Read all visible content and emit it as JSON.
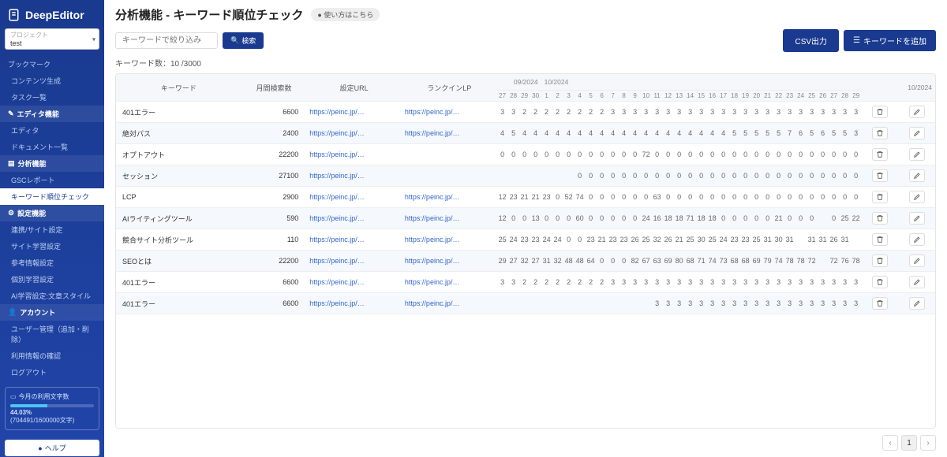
{
  "app_name": "DeepEditor",
  "project": {
    "label": "プロジェクト",
    "value": "test"
  },
  "sidebar": {
    "items": [
      {
        "label": "ブックマーク",
        "type": "item"
      },
      {
        "label": "コンテンツ生成",
        "type": "sub"
      },
      {
        "label": "タスク一覧",
        "type": "sub"
      },
      {
        "label": "エディタ機能",
        "type": "section",
        "icon": "edit"
      },
      {
        "label": "エディタ",
        "type": "sub"
      },
      {
        "label": "ドキュメント一覧",
        "type": "sub"
      },
      {
        "label": "分析機能",
        "type": "section",
        "icon": "chart"
      },
      {
        "label": "GSCレポート",
        "type": "sub"
      },
      {
        "label": "キーワード順位チェック",
        "type": "sub",
        "active": true
      },
      {
        "label": "設定機能",
        "type": "section",
        "icon": "gear"
      },
      {
        "label": "連携/サイト設定",
        "type": "sub"
      },
      {
        "label": "サイト学習設定",
        "type": "sub"
      },
      {
        "label": "参考情報設定",
        "type": "sub"
      },
      {
        "label": "個別学習設定",
        "type": "sub"
      },
      {
        "label": "AI学習設定:文章スタイル",
        "type": "sub"
      },
      {
        "label": "アカウント",
        "type": "section",
        "icon": "user"
      },
      {
        "label": "ユーザー管理（追加・削除）",
        "type": "sub"
      },
      {
        "label": "利用情報の確認",
        "type": "sub"
      },
      {
        "label": "ログアウト",
        "type": "sub"
      }
    ],
    "usage": {
      "title": "今月の利用文字数",
      "percent": "44.03%",
      "detail": "(704491/1600000文字)"
    },
    "help": "ヘルプ"
  },
  "header": {
    "title": "分析機能 - キーワード順位チェック",
    "howto": "● 使い方はこちら"
  },
  "toolbar": {
    "search_placeholder": "キーワードで絞り込み",
    "search_btn": "検索",
    "csv_btn": "CSV出力",
    "add_btn": "キーワードを追加"
  },
  "count_label": "キーワード数：10 /3000",
  "table": {
    "cols": {
      "keyword": "キーワード",
      "volume": "月間検索数",
      "url": "設定URL",
      "rank_lp": "ランクインLP"
    },
    "month_groups": [
      {
        "label": "09/2024",
        "days": [
          "27",
          "28",
          "29",
          "30"
        ]
      },
      {
        "label": "10/2024",
        "days": [
          "1",
          "2",
          "3",
          "4",
          "5",
          "6",
          "7",
          "8",
          "9",
          "10",
          "11",
          "12",
          "13",
          "14",
          "15",
          "16",
          "17",
          "18",
          "19",
          "20",
          "21",
          "22",
          "23",
          "24",
          "25",
          "26",
          "27",
          "28",
          "29"
        ]
      }
    ],
    "month_right_label": "10/2024",
    "rows": [
      {
        "kw": "401エラー",
        "vol": "6600",
        "url": "https://peinc.jp/…",
        "lp": "https://peinc.jp/…",
        "ranks": [
          "3",
          "3",
          "2",
          "2",
          "2",
          "2",
          "2",
          "2",
          "2",
          "2",
          "3",
          "3",
          "3",
          "3",
          "3",
          "3",
          "3",
          "3",
          "3",
          "3",
          "3",
          "3",
          "3",
          "3",
          "3",
          "3",
          "3",
          "3",
          "3",
          "3",
          "3",
          "3",
          "3"
        ]
      },
      {
        "kw": "絶対パス",
        "vol": "2400",
        "url": "https://peinc.jp/…",
        "lp": "https://peinc.jp/…",
        "ranks": [
          "4",
          "5",
          "4",
          "4",
          "4",
          "4",
          "4",
          "4",
          "4",
          "4",
          "4",
          "4",
          "4",
          "4",
          "4",
          "4",
          "4",
          "4",
          "4",
          "4",
          "4",
          "5",
          "5",
          "5",
          "5",
          "5",
          "7",
          "6",
          "5",
          "6",
          "5",
          "5",
          "3"
        ]
      },
      {
        "kw": "オプトアウト",
        "vol": "22200",
        "url": "https://peinc.jp/…",
        "lp": "",
        "ranks": [
          "0",
          "0",
          "0",
          "0",
          "0",
          "0",
          "0",
          "0",
          "0",
          "0",
          "0",
          "0",
          "0",
          "72",
          "0",
          "0",
          "0",
          "0",
          "0",
          "0",
          "0",
          "0",
          "0",
          "0",
          "0",
          "0",
          "0",
          "0",
          "0",
          "0",
          "0",
          "0",
          "0"
        ]
      },
      {
        "kw": "セッション",
        "vol": "27100",
        "url": "https://peinc.jp/…",
        "lp": "",
        "ranks": [
          "",
          "",
          "",
          "",
          "",
          "",
          "",
          "0",
          "0",
          "0",
          "0",
          "0",
          "0",
          "0",
          "0",
          "0",
          "0",
          "0",
          "0",
          "0",
          "0",
          "0",
          "0",
          "0",
          "0",
          "0",
          "0",
          "0",
          "0",
          "0",
          "0",
          "0",
          "0"
        ]
      },
      {
        "kw": "LCP",
        "vol": "2900",
        "url": "https://peinc.jp/…",
        "lp": "https://peinc.jp/…",
        "ranks": [
          "12",
          "23",
          "21",
          "21",
          "23",
          "0",
          "52",
          "74",
          "0",
          "0",
          "0",
          "0",
          "0",
          "0",
          "63",
          "0",
          "0",
          "0",
          "0",
          "0",
          "0",
          "0",
          "0",
          "0",
          "0",
          "0",
          "0",
          "0",
          "0",
          "0",
          "0",
          "0",
          "0"
        ]
      },
      {
        "kw": "AIライティングツール",
        "vol": "590",
        "url": "https://peinc.jp/…",
        "lp": "https://peinc.jp/…",
        "ranks": [
          "12",
          "0",
          "0",
          "13",
          "0",
          "0",
          "0",
          "60",
          "0",
          "0",
          "0",
          "0",
          "0",
          "24",
          "16",
          "18",
          "18",
          "71",
          "18",
          "18",
          "0",
          "0",
          "0",
          "0",
          "0",
          "21",
          "0",
          "0",
          "0",
          "",
          "0",
          "25",
          "22"
        ]
      },
      {
        "kw": "競合サイト分析ツール",
        "vol": "110",
        "url": "https://peinc.jp/…",
        "lp": "https://peinc.jp/…",
        "ranks": [
          "25",
          "24",
          "23",
          "23",
          "24",
          "24",
          "0",
          "0",
          "23",
          "21",
          "23",
          "23",
          "26",
          "25",
          "32",
          "26",
          "21",
          "25",
          "30",
          "25",
          "24",
          "23",
          "23",
          "25",
          "31",
          "30",
          "31",
          "",
          "31",
          "31",
          "26",
          "31",
          "",
          ""
        ]
      },
      {
        "kw": "SEOとは",
        "vol": "22200",
        "url": "https://peinc.jp/…",
        "lp": "https://peinc.jp/…",
        "ranks": [
          "29",
          "27",
          "32",
          "27",
          "31",
          "32",
          "48",
          "48",
          "64",
          "0",
          "0",
          "0",
          "82",
          "67",
          "63",
          "69",
          "80",
          "68",
          "71",
          "74",
          "73",
          "68",
          "68",
          "69",
          "79",
          "74",
          "78",
          "78",
          "72",
          "",
          "72",
          "76",
          "78"
        ]
      },
      {
        "kw": "401エラー",
        "vol": "6600",
        "url": "https://peinc.jp/…",
        "lp": "https://peinc.jp/…",
        "ranks": [
          "3",
          "3",
          "2",
          "2",
          "2",
          "2",
          "2",
          "2",
          "2",
          "2",
          "3",
          "3",
          "3",
          "3",
          "3",
          "3",
          "3",
          "3",
          "3",
          "3",
          "3",
          "3",
          "3",
          "3",
          "3",
          "3",
          "3",
          "3",
          "3",
          "3",
          "3",
          "3",
          "3"
        ]
      },
      {
        "kw": "401エラー",
        "vol": "6600",
        "url": "https://peinc.jp/…",
        "lp": "https://peinc.jp/…",
        "ranks": [
          "",
          "",
          "",
          "",
          "",
          "",
          "",
          "",
          "",
          "",
          "",
          "",
          "",
          "",
          "3",
          "3",
          "3",
          "3",
          "3",
          "3",
          "3",
          "3",
          "3",
          "3",
          "3",
          "3",
          "3",
          "3",
          "3",
          "3",
          "3",
          "3",
          "3"
        ]
      }
    ]
  },
  "pager": {
    "page": "1"
  }
}
